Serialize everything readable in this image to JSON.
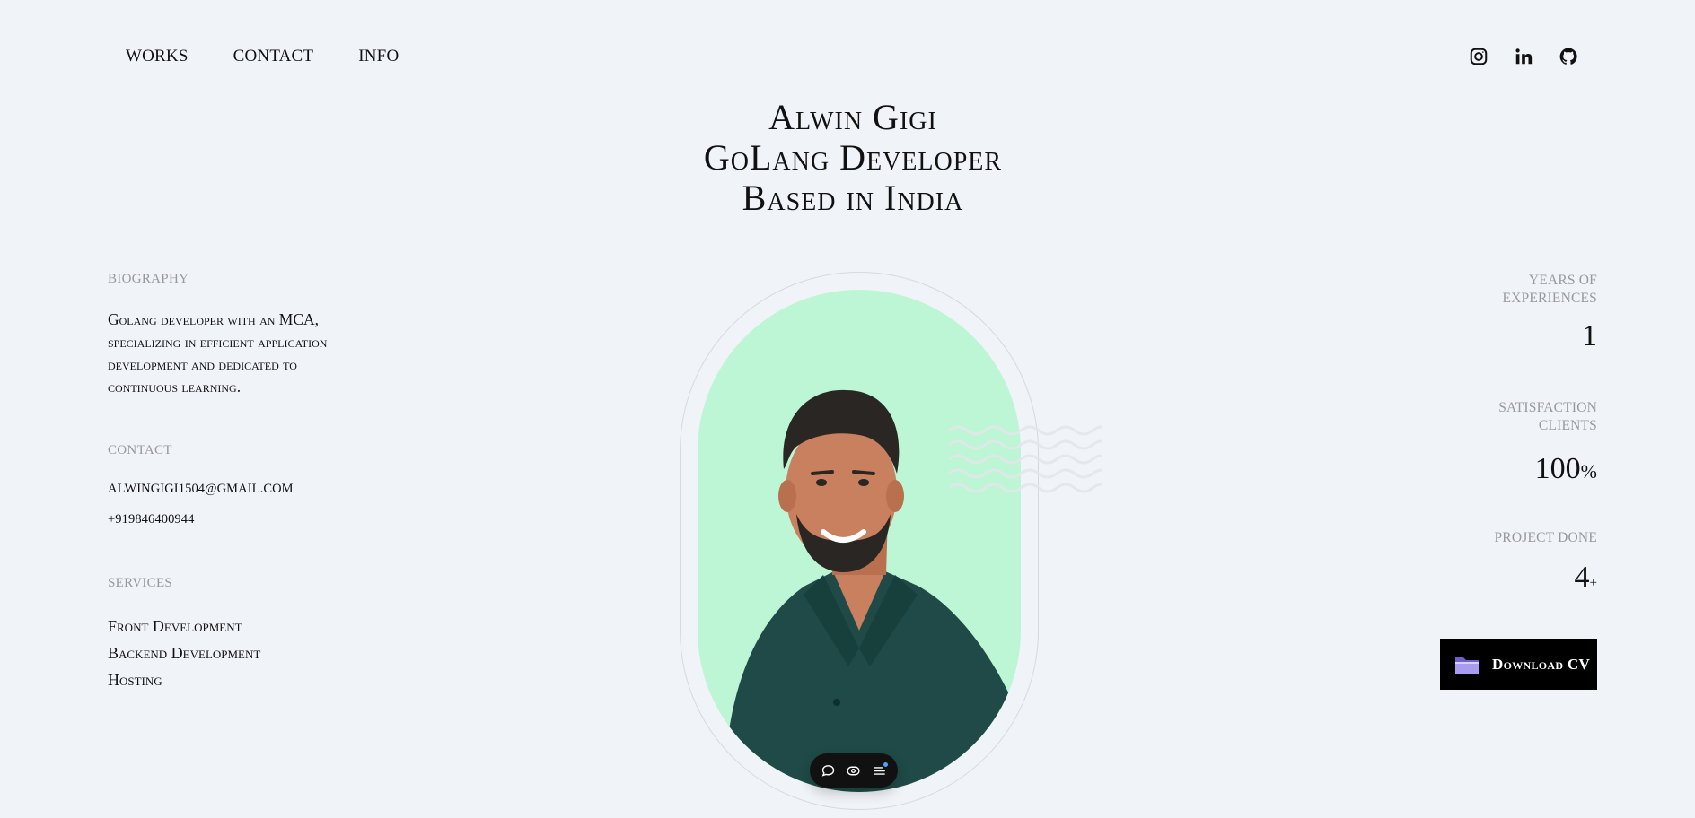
{
  "nav": {
    "items": [
      "WORKS",
      "CONTACT",
      "INFO"
    ]
  },
  "socials": [
    {
      "icon": "instagram-icon",
      "label": "Instagram"
    },
    {
      "icon": "linkedin-icon",
      "label": "LinkedIn"
    },
    {
      "icon": "github-icon",
      "label": "GitHub"
    }
  ],
  "hero": {
    "line1": "Alwin Gigi",
    "line2": "GoLang Developer",
    "line3": "Based in India"
  },
  "biography": {
    "label": "BIOGRAPHY",
    "text": "Golang developer with an MCA, specializing in efficient application development and dedicated to continuous learning."
  },
  "contact": {
    "label": "CONTACT",
    "email": "alwingigi1504@gmail.com",
    "phone": "+919846400944"
  },
  "services": {
    "label": "SERVICES",
    "items": [
      "Front Development",
      "Backend Development",
      "Hosting"
    ]
  },
  "stats": {
    "experience_label": "YEARS OF EXPERIENCES",
    "experience_value": "1",
    "satisfaction_label": "SATISFACTION CLIENTS",
    "satisfaction_value": "100",
    "satisfaction_suffix": "%",
    "projects_label": "PROJECT DONE",
    "projects_value": "4",
    "projects_suffix": "+"
  },
  "cv_button": {
    "label": "Download CV",
    "icon": "folder-icon"
  },
  "toolbar": {
    "icons": [
      "chat-icon",
      "eye-icon",
      "menu-icon"
    ]
  },
  "colors": {
    "background": "#f0f3f8",
    "portrait_bg": "#bdf6d4",
    "button_bg": "#000000",
    "muted_label": "#999999"
  }
}
